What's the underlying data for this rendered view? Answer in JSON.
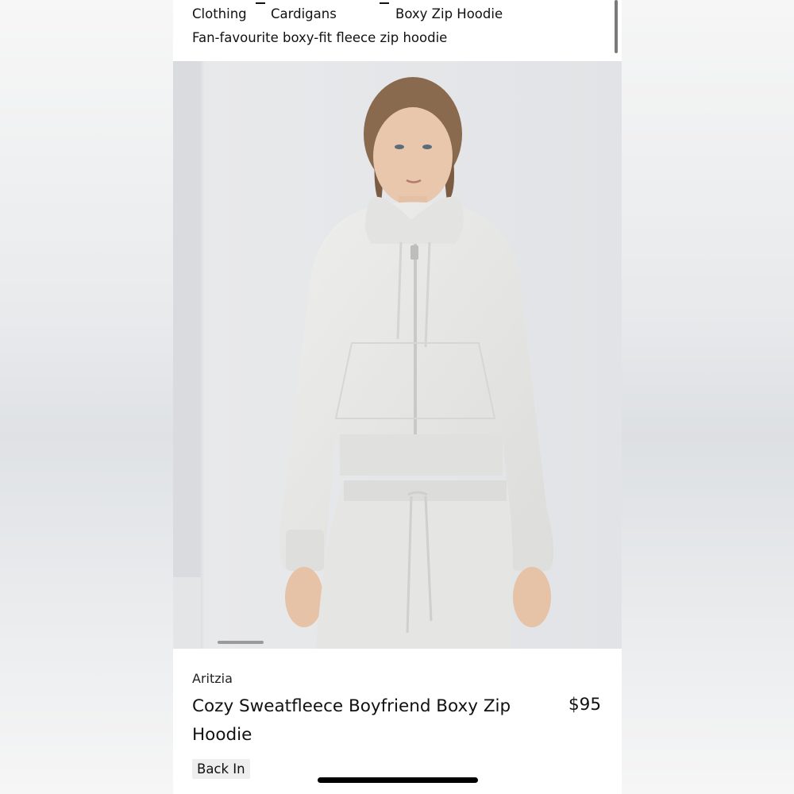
{
  "breadcrumb": {
    "items": [
      "Clothing",
      "Cardigans",
      "Boxy Zip Hoodie"
    ]
  },
  "header": {
    "subtitle": "Fan-favourite boxy-fit fleece zip hoodie"
  },
  "product": {
    "brand": "Aritzia",
    "name": "Cozy Sweatfleece Boyfriend Boxy Zip Hoodie",
    "price": "$95",
    "badge": "Back In"
  },
  "colors": {
    "background": "#ffffff",
    "text": "#111111",
    "badge_bg": "#eeeeee",
    "garment": "#e7e7e5",
    "photo_bg": "#e2e4e7"
  },
  "icons": [
    "carousel-indicator",
    "scrollbar",
    "home-indicator"
  ]
}
